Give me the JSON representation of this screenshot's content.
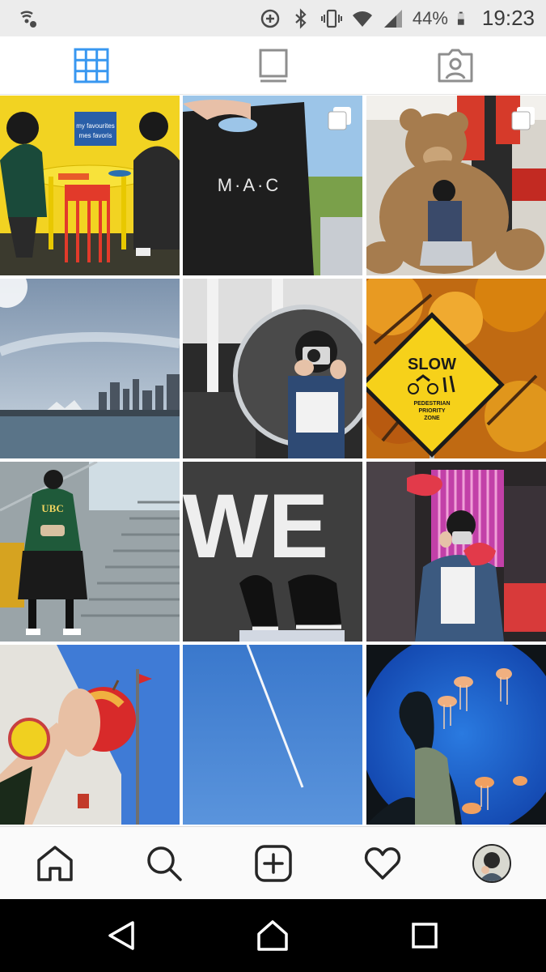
{
  "status_bar": {
    "battery_percent": "44%",
    "time": "19:23",
    "icons": [
      "wifi-calling-icon",
      "data-saver-icon",
      "bluetooth-icon",
      "vibrate-icon",
      "wifi-icon",
      "signal-icon",
      "battery-icon"
    ]
  },
  "profile_tabs": {
    "items": [
      {
        "id": "grid",
        "icon": "grid-icon",
        "active": true
      },
      {
        "id": "feed",
        "icon": "feed-view-icon",
        "active": false
      },
      {
        "id": "tagged",
        "icon": "tagged-icon",
        "active": false
      }
    ],
    "active_color": "#3897f0",
    "inactive_color": "#8e8e8e"
  },
  "posts": [
    {
      "subject": "two girls at yellow table with sign",
      "sign_text": [
        "my favourites",
        "mes favoris"
      ],
      "multi": false
    },
    {
      "subject": "black shopping bag",
      "bag_text": "M·A·C",
      "multi": true
    },
    {
      "subject": "girl with giant teddy bear",
      "multi": true
    },
    {
      "subject": "city skyline over water",
      "multi": false
    },
    {
      "subject": "mirror selfie with camera",
      "multi": false
    },
    {
      "subject": "autumn tree with road sign",
      "sign_lines": [
        "SLOW",
        "PEDESTRIAN",
        "PRIORITY",
        "ZONE"
      ],
      "multi": false
    },
    {
      "subject": "girl in green sweater on stairs",
      "sweater_text": "UBC",
      "multi": false
    },
    {
      "subject": "sneakers on painted asphalt",
      "road_text": "WE",
      "multi": false
    },
    {
      "subject": "girl with camera and neon wall",
      "multi": false
    },
    {
      "subject": "hand holding red apple",
      "multi": false
    },
    {
      "subject": "airplane contrail in blue sky",
      "multi": false
    },
    {
      "subject": "jellyfish aquarium silhouette",
      "multi": false
    }
  ],
  "bottom_nav": {
    "items": [
      "home-icon",
      "search-icon",
      "new-post-icon",
      "activity-heart-icon",
      "profile-avatar"
    ]
  },
  "system_nav": {
    "items": [
      "back-button",
      "home-button",
      "recents-button"
    ]
  }
}
